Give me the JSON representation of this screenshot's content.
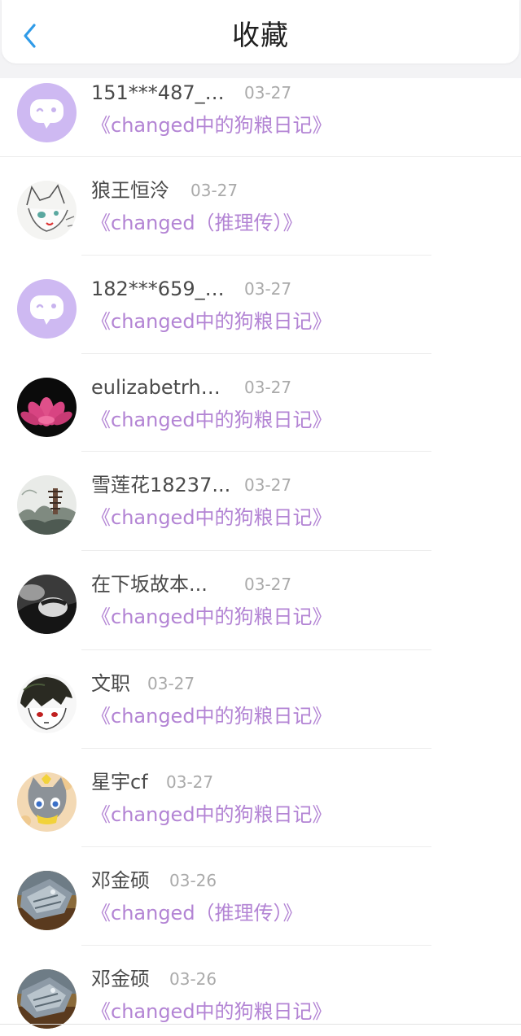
{
  "header": {
    "title": "收藏",
    "back_icon": "chevron-left-icon",
    "accent_color": "#2f9be8"
  },
  "colors": {
    "collection_link": "#b384d4",
    "date": "#aaaaaa",
    "username": "#4a4a4a"
  },
  "favorites": [
    {
      "username": "151***487_8...",
      "date": "03-27",
      "collection": "《changed中的狗粮日记》",
      "avatar": "default-chat-bubble-avatar"
    },
    {
      "username": "狼王恒泠",
      "date": "03-27",
      "collection": "《changed（推理传）》",
      "avatar": "white-wolf-sketch-avatar"
    },
    {
      "username": "182***659_6...",
      "date": "03-27",
      "collection": "《changed中的狗粮日记》",
      "avatar": "default-chat-bubble-avatar"
    },
    {
      "username": "eulizabetrha...",
      "date": "03-27",
      "collection": "《changed中的狗粮日记》",
      "avatar": "lotus-flower-avatar"
    },
    {
      "username": "雪莲花18237...",
      "date": "03-27",
      "collection": "《changed中的狗粮日记》",
      "avatar": "pagoda-landscape-avatar"
    },
    {
      "username": "在下坂故本...",
      "date": "03-27",
      "collection": "《changed中的狗粮日记》",
      "avatar": "sleeping-figure-avatar"
    },
    {
      "username": "文职",
      "date": "03-27",
      "collection": "《changed中的狗粮日记》",
      "avatar": "anime-character-avatar"
    },
    {
      "username": "星宇cf",
      "date": "03-27",
      "collection": "《changed中的狗粮日记》",
      "avatar": "gray-cat-character-avatar"
    },
    {
      "username": "邓金硕",
      "date": "03-26",
      "collection": "《changed（推理传）》",
      "avatar": "spaceship-avatar"
    },
    {
      "username": "邓金硕",
      "date": "03-26",
      "collection": "《changed中的狗粮日记》",
      "avatar": "spaceship-avatar"
    }
  ]
}
